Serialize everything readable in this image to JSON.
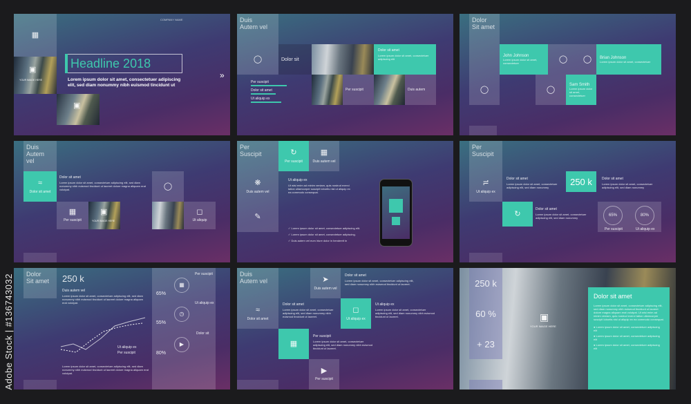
{
  "slide1": {
    "headline": "Headline 2018",
    "body": "Lorem ipsum dolor sit amet, consectetuer adipiscing elit, sed diam nonummy nibh euismod tincidunt ut",
    "img": "YOUR IMAGE HERE",
    "company": "COMPANY NAME",
    "arrow": "»"
  },
  "slide2": {
    "title1": "Duis",
    "title2": "Autem vel",
    "dolor": "Dolor sit",
    "dolor_amet": "Dolor sit amet",
    "per": "Per suscipit",
    "dolor_amet2": "Dolor sit amet",
    "duis": "Duis autem",
    "ut": "Ut aliquip ex",
    "txt": "Lorem ipsum dolor sit amet, consectetuer adipiscing elit"
  },
  "slide3": {
    "title1": "Dolor",
    "title2": "Sit amet",
    "p1": "John Johnson",
    "p2": "Brian Johnson",
    "p3": "Sam Smith",
    "txt": "Lorem ipsum dolor sit amet, consectetuer"
  },
  "slide4": {
    "title1": "Duis",
    "title2": "Autem vel",
    "dolor_amet": "Dolor sit amet",
    "dolor_amet_t": "Dolor sit amet",
    "per": "Per suscipit",
    "ut": "Ut aliquip",
    "img": "YOUR IMAGE HERE",
    "txt": "Lorem ipsum dolor sit amet, consectetuer adipiscing elit, sed diam nonummy nibh euismod tincidunt ut laoreet dolore magna aliquam erat volutpat."
  },
  "slide5": {
    "title1": "Per",
    "title2": "Suscipit",
    "per": "Per suscipit",
    "duis": "Duis autem vel",
    "duis2": "Duis autem vel",
    "ut": "Ut aliquip ex",
    "checks": [
      "Lorem ipsum dolor sit amet, consectetuer adipiscing elit.",
      "Lorem ipsum dolor sit amet, consectetuer adipiscing.",
      "Duis autem vel eum iriure dolor in hendrerit in"
    ],
    "txt": "Ut wisi enim ad minim veniam, quis nostrud exerci tation ullamcorper suscipit lobortis nisl ut aliquip ex ea commodo consequat."
  },
  "slide6": {
    "title1": "Per",
    "title2": "Suscipit",
    "value": "250 k",
    "dolor1": "Dolor sit amet",
    "dolor2": "Dolor sit amet",
    "dolor3": "Dolor sit amet",
    "ut": "Ut aliquip ex",
    "per": "Per suscipit",
    "pct1": "65%",
    "pct2": "80%",
    "pct_lbl": "Ut aliquip ex",
    "txt": "Lorem ipsum dolor sit amet, consectetuer adipiscing elit, sed diam nonummy"
  },
  "slide7": {
    "title1": "Dolor",
    "title2": "Sit amet",
    "value": "250 k",
    "duis": "Duis autem vel",
    "per": "Per suscipit",
    "ut": "Ut aliquip ex",
    "dolor": "Dolor sit",
    "pct1": "65%",
    "pct2": "55%",
    "pct3": "80%",
    "leg1": "Ut aliquip ex",
    "leg2": "Per suscipit",
    "txt": "Lorem ipsum dolor sit amet, consectetuer adipiscing elit, sed diam nonummy nibh euismod tincidunt ut laoreet dolore magna aliquam erat volutpat."
  },
  "slide8": {
    "title1": "Duis",
    "title2": "Autem vel",
    "duis": "Duis autem vel",
    "dolor_amet": "Dolor sit amet",
    "dolor_amet2": "Dolor sit amet",
    "ut": "Ut aliquip ex",
    "ut2": "Ut aliquip ex",
    "per": "Per suscipit",
    "per2": "Per suscipit",
    "dolor3": "Dolor sit amet",
    "txt": "Lorem ipsum dolor sit amet, consectetuer adipiscing elit, sed diam nonummy nibh euismod tincidunt ut laoreet."
  },
  "slide9": {
    "v1": "250 k",
    "v2": "60 %",
    "v3": "+ 23",
    "title": "Dolor sit amet",
    "img": "YOUR IMAGE HERE",
    "txt": "Lorem ipsum dolor sit amet, consectetuer adipiscing elit, sed diam nonummy nibh euismod tincidunt ut laoreet dolore magna aliquam erat volutpat. Ut wisi enim ad minim veniam, quis nostrud exerci tation ullamcorper suscipit lobortis nisl ut aliquip ex ea commodo consequat.",
    "bullet": "Lorem ipsum dolor sit amet, consectetuer adipiscing elit"
  },
  "watermark": "Adobe Stock | #136743032",
  "colors": {
    "teal": "#3ec8ad",
    "purple": "#4a2d66",
    "bg": "#1b1b1d"
  }
}
